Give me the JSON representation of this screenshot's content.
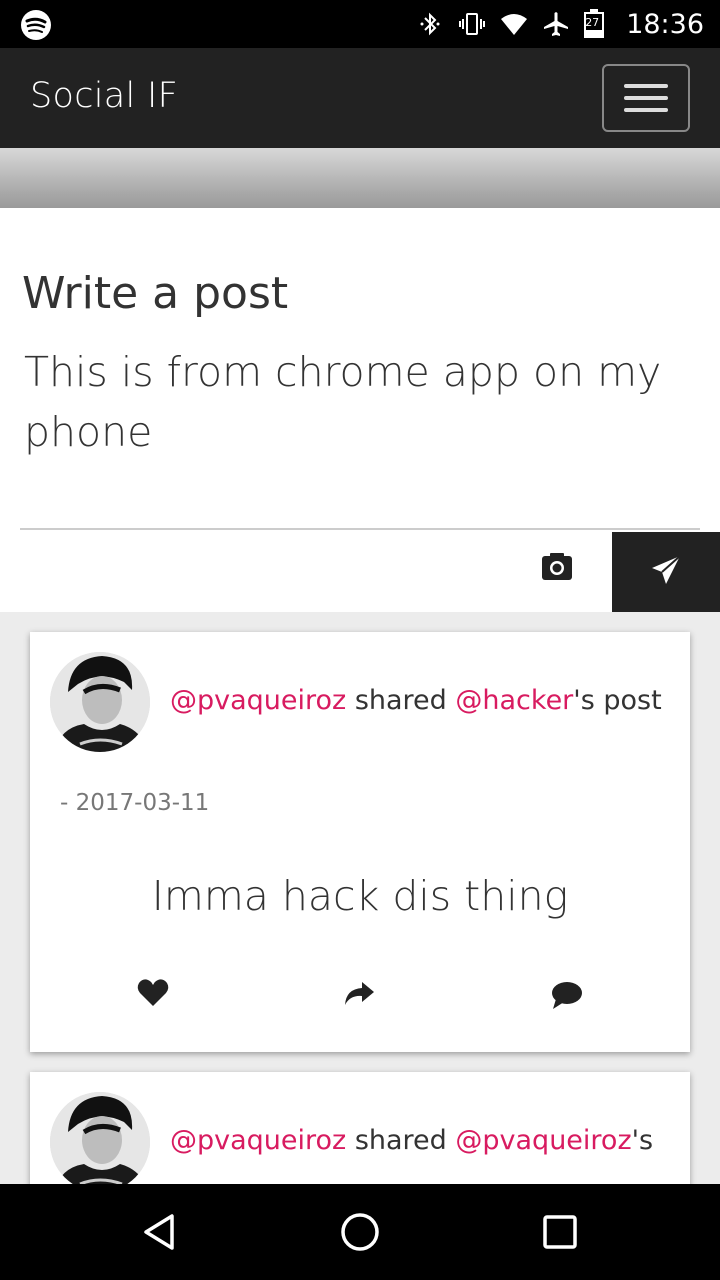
{
  "status_bar": {
    "time": "18:36",
    "battery_level": "27",
    "icons": [
      "spotify-icon",
      "bluetooth-icon",
      "vibrate-icon",
      "wifi-icon",
      "airplane-icon",
      "battery-icon"
    ]
  },
  "navbar": {
    "brand": "Social IF",
    "menu_icon": "hamburger-icon"
  },
  "compose": {
    "heading": "Write a post",
    "text_value": "This is from chrome app on my phone",
    "camera_icon": "camera-icon",
    "send_icon": "paper-plane-icon"
  },
  "posts": [
    {
      "user": "@pvaqueiroz",
      "shared_text": " shared ",
      "original_user": "@hacker",
      "suffix": "'s post",
      "date": "- 2017-03-11",
      "body": "Imma hack dis thing",
      "actions": [
        "heart-icon",
        "share-icon",
        "comment-icon"
      ]
    },
    {
      "user": "@pvaqueiroz",
      "shared_text": " shared ",
      "original_user": "@pvaqueiroz",
      "suffix": "'s"
    }
  ],
  "colors": {
    "mention": "#d81b60",
    "navbar_bg": "#222222"
  }
}
